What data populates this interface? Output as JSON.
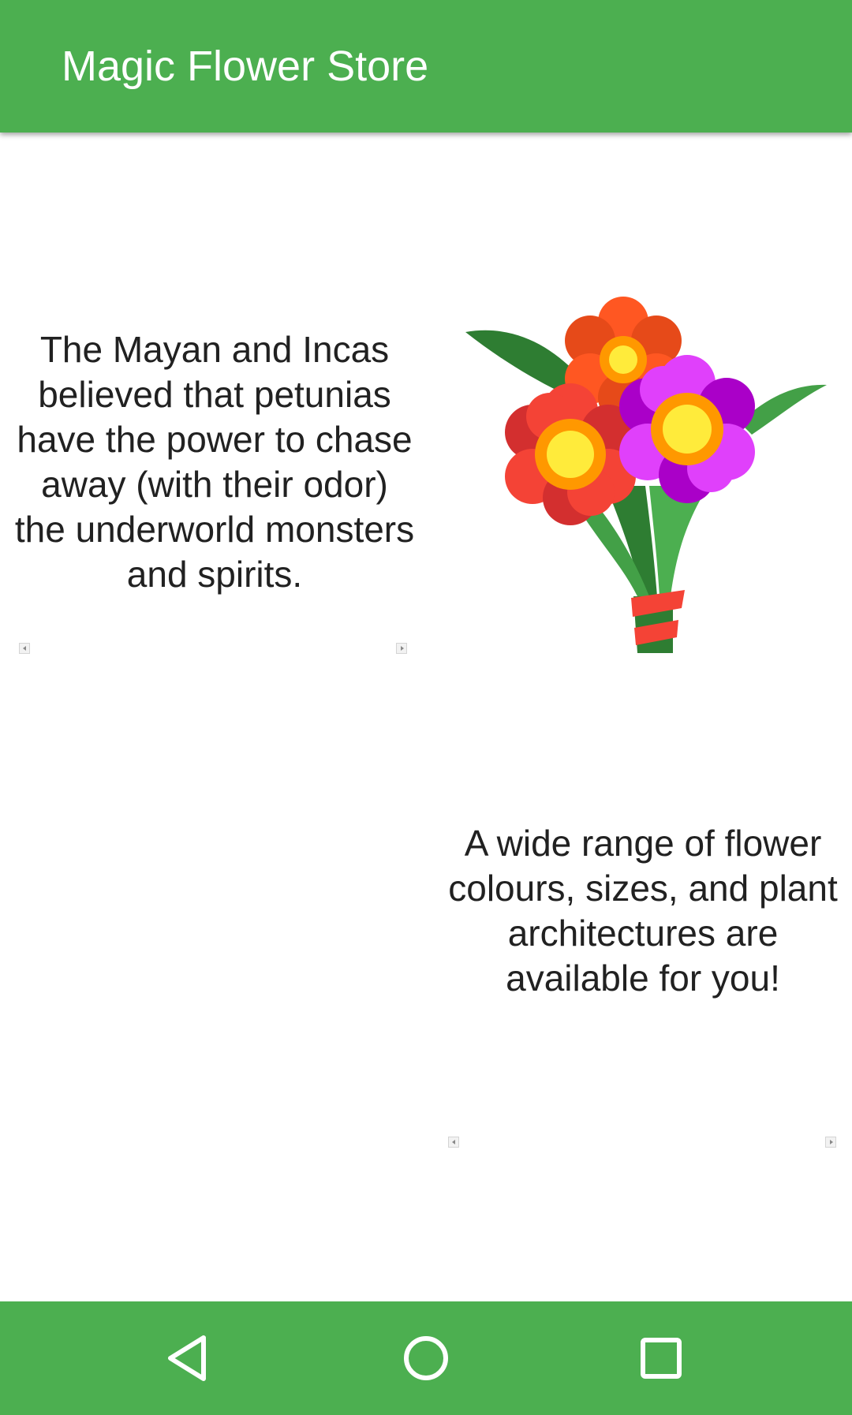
{
  "app_bar": {
    "title": "Magic Flower Store"
  },
  "cards": [
    {
      "text": "The Mayan and Incas believed that petunias have the power to chase away (with their odor) the underworld monsters and spirits."
    },
    {
      "text": "A wide range of flower colours, sizes, and plant architectures are available for you!"
    }
  ],
  "nav_bar": {
    "back_icon": "back-triangle-icon",
    "home_icon": "home-circle-icon",
    "recent_icon": "recent-apps-square-icon"
  },
  "colors": {
    "primary": "#4caf50",
    "text": "#212121",
    "background": "#ffffff"
  }
}
